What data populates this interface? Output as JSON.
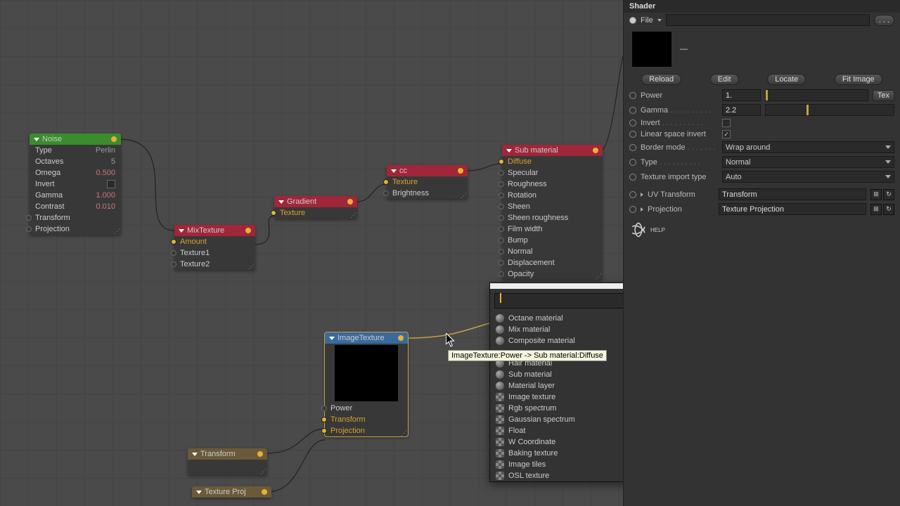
{
  "sidepanel": {
    "title": "Shader",
    "file_label": "File",
    "file_value": "",
    "file_btn": ". . .",
    "preview_dash": "—",
    "buttons": {
      "reload": "Reload",
      "edit": "Edit",
      "locate": "Locate",
      "fit": "Fit Image"
    },
    "power": {
      "label": "Power",
      "value": "1.",
      "tex_btn": "Tex"
    },
    "gamma": {
      "label": "Gamma",
      "value": "2.2"
    },
    "invert": {
      "label": "Invert",
      "checked": false
    },
    "lsi": {
      "label": "Linear space invert",
      "checked": true
    },
    "border": {
      "label": "Border mode",
      "value": "Wrap around"
    },
    "type": {
      "label": "Type",
      "value": "Normal"
    },
    "teximport": {
      "label": "Texture import type",
      "value": "Auto"
    },
    "uv": {
      "label": "UV Transform",
      "value": "Transform"
    },
    "proj": {
      "label": "Projection",
      "value": "Texture Projection"
    },
    "help": "HELP"
  },
  "tooltip": "ImageTexture:Power  ->  Sub material:Diffuse",
  "popup": {
    "items": [
      {
        "label": "Octane material",
        "kind": "ball"
      },
      {
        "label": "Mix material",
        "kind": "ball"
      },
      {
        "label": "Composite material",
        "kind": "ball"
      },
      {
        "label": "Hair material",
        "kind": "ball"
      },
      {
        "label": "Sub material",
        "kind": "ball"
      },
      {
        "label": "Material layer",
        "kind": "ball"
      },
      {
        "label": "Image texture",
        "kind": "sq"
      },
      {
        "label": "Rgb spectrum",
        "kind": "sq"
      },
      {
        "label": "Gaussian spectrum",
        "kind": "sq"
      },
      {
        "label": "Float",
        "kind": "sq"
      },
      {
        "label": "W Coordinate",
        "kind": "sq"
      },
      {
        "label": "Baking texture",
        "kind": "sq"
      },
      {
        "label": "Image tiles",
        "kind": "sq"
      },
      {
        "label": "OSL texture",
        "kind": "sq"
      }
    ]
  },
  "nodes": {
    "noise": {
      "title": "Noise",
      "rows": {
        "type": {
          "k": "Type",
          "v": "Perlin"
        },
        "oct": {
          "k": "Octaves",
          "v": "5"
        },
        "omega": {
          "k": "Omega",
          "v": "0.500"
        },
        "invert": {
          "k": "Invert",
          "v": ""
        },
        "gamma": {
          "k": "Gamma",
          "v": "1.000"
        },
        "contrast": {
          "k": "Contrast",
          "v": "0.010"
        },
        "transform": {
          "k": "Transform",
          "v": ""
        },
        "projection": {
          "k": "Projection",
          "v": ""
        }
      }
    },
    "mix": {
      "title": "MixTexture",
      "rows": {
        "amount": "Amount",
        "t1": "Texture1",
        "t2": "Texture2"
      }
    },
    "gradient": {
      "title": "Gradient",
      "rows": {
        "tex": "Texture"
      }
    },
    "cc": {
      "title": "cc",
      "rows": {
        "tex": "Texture",
        "bright": "Brightness"
      }
    },
    "sub": {
      "title": "Sub material",
      "rows": [
        "Diffuse",
        "Specular",
        "Roughness",
        "Rotation",
        "Sheen",
        "Sheen roughness",
        "Film width",
        "Bump",
        "Normal",
        "Displacement",
        "Opacity"
      ]
    },
    "img": {
      "title": "ImageTexture",
      "rows": {
        "power": "Power",
        "transform": "Transform",
        "projection": "Projection"
      }
    },
    "transform": {
      "title": "Transform"
    },
    "texproj": {
      "title": "Texture Proj"
    }
  }
}
